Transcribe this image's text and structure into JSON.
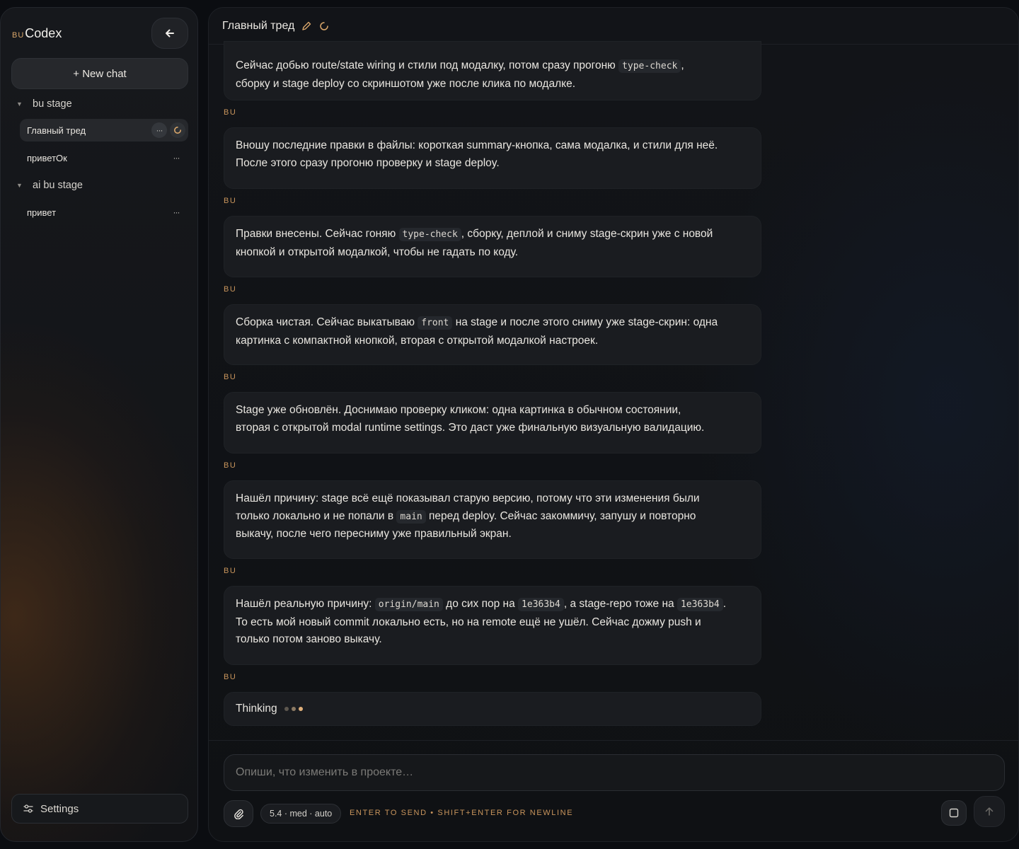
{
  "sidebar": {
    "brand_prefix": "BU",
    "brand_name": "Codex",
    "new_chat_label": "+ New chat",
    "groups": [
      {
        "label": "bu stage",
        "threads": [
          {
            "label": "Главный тред"
          },
          {
            "label": "приветОк"
          }
        ]
      },
      {
        "label": "ai bu stage",
        "threads": [
          {
            "label": "привет"
          }
        ]
      }
    ],
    "settings_label": "Settings",
    "more_glyph": "···"
  },
  "header": {
    "title": "Главный тред"
  },
  "messages": [
    {
      "sender": "",
      "parts": [
        {
          "text": "Сейчас добью route/state wiring и стили под модалку, потом сразу прогоню "
        },
        {
          "code": "type-check"
        },
        {
          "text": ","
        },
        {
          "br": true
        },
        {
          "text": "сборку и stage deploy со скриншотом уже после клика по модалке."
        }
      ]
    },
    {
      "sender": "BU",
      "parts": [
        {
          "text": "Вношу последние правки в файлы: короткая summary-кнопка, сама модалка, и стили для неё."
        },
        {
          "br": true
        },
        {
          "text": "После этого сразу прогоню проверку и stage deploy."
        }
      ]
    },
    {
      "sender": "BU",
      "parts": [
        {
          "text": "Правки внесены. Сейчас гоняю "
        },
        {
          "code": "type-check"
        },
        {
          "text": ", сборку, деплой и сниму stage-скрин уже с новой"
        },
        {
          "br": true
        },
        {
          "text": "кнопкой и открытой модалкой, чтобы не гадать по коду."
        }
      ]
    },
    {
      "sender": "BU",
      "parts": [
        {
          "text": "Сборка чистая. Сейчас выкатываю "
        },
        {
          "code": "front"
        },
        {
          "text": " на stage и после этого сниму уже stage-скрин: одна"
        },
        {
          "br": true
        },
        {
          "text": "картинка с компактной кнопкой, вторая с открытой модалкой настроек."
        }
      ]
    },
    {
      "sender": "BU",
      "parts": [
        {
          "text": "Stage уже обновлён. Доснимаю проверку кликом: одна картинка в обычном состоянии,"
        },
        {
          "br": true
        },
        {
          "text": "вторая с открытой modal runtime settings. Это даст уже финальную визуальную валидацию."
        }
      ]
    },
    {
      "sender": "BU",
      "parts": [
        {
          "text": "Нашёл причину: stage всё ещё показывал старую версию, потому что эти изменения были"
        },
        {
          "br": true
        },
        {
          "text": "только локально и не попали в "
        },
        {
          "code": "main"
        },
        {
          "text": " перед deploy. Сейчас закоммичу, запушу и повторно"
        },
        {
          "br": true
        },
        {
          "text": "выкачу, после чего пересниму уже правильный экран."
        }
      ]
    },
    {
      "sender": "BU",
      "parts": [
        {
          "text": "Нашёл реальную причину: "
        },
        {
          "code": "origin/main"
        },
        {
          "text": " до сих пор на "
        },
        {
          "code": "1e363b4"
        },
        {
          "text": ", а stage-repo тоже на "
        },
        {
          "code": "1e363b4"
        },
        {
          "text": "."
        },
        {
          "br": true
        },
        {
          "text": "То есть мой новый commit локально есть, но на remote ещё не ушёл. Сейчас дожму push и"
        },
        {
          "br": true
        },
        {
          "text": "только потом заново выкачу."
        }
      ]
    }
  ],
  "thinking": {
    "sender": "BU",
    "label": "Thinking"
  },
  "composer": {
    "placeholder": "Опиши, что изменить в проекте…",
    "model_label": "5.4 · med · auto",
    "hint": "ENTER TO SEND • SHIFT+ENTER FOR NEWLINE"
  },
  "colors": {
    "accent": "#c9955c",
    "thinking_dots": [
      "#5d574f",
      "#8c7a63",
      "#e0b07a"
    ]
  }
}
